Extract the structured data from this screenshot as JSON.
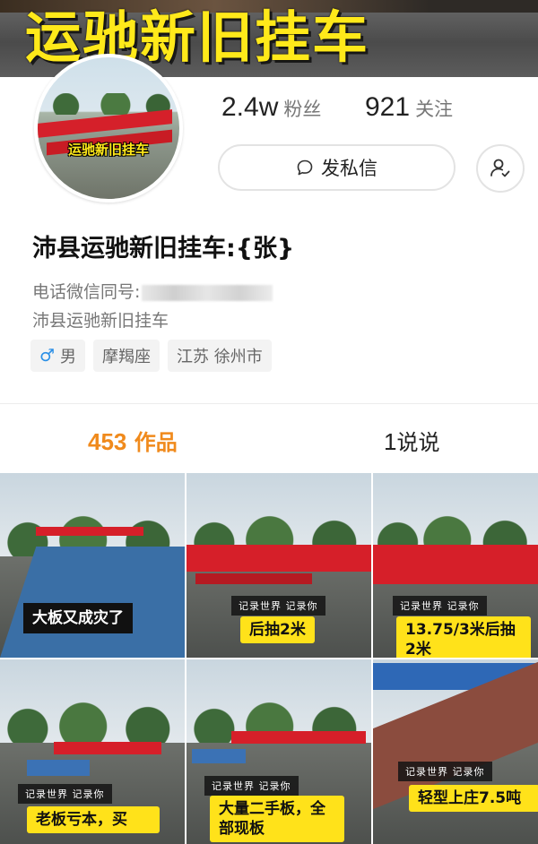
{
  "banner": {
    "title": "运驰新旧挂车"
  },
  "avatar": {
    "label": "运驰新旧挂车"
  },
  "stats": {
    "fans_count": "2.4w",
    "fans_label": "粉丝",
    "follow_count": "921",
    "follow_label": "关注"
  },
  "actions": {
    "message_label": "发私信"
  },
  "profile": {
    "name": "沛县运驰新旧挂车:{张}",
    "bio_line1": "电话微信同号:",
    "bio_line2": "沛县运驰新旧挂车",
    "tags": {
      "gender": "男",
      "zodiac": "摩羯座",
      "location": "江苏 徐州市"
    }
  },
  "tabs": {
    "works_count": "453",
    "works_label": "作品",
    "talk_count": "1",
    "talk_label": "说说"
  },
  "videos": [
    {
      "caption": "大板又成灾了"
    },
    {
      "record": "记录世界 记录你",
      "caption": "后抽2米"
    },
    {
      "record": "记录世界 记录你",
      "caption": "13.75/3米后抽2米"
    },
    {
      "record": "记录世界 记录你",
      "caption": "老板亏本，买"
    },
    {
      "record": "记录世界 记录你",
      "caption": "大量二手板，全部现板"
    },
    {
      "record": "记录世界 记录你",
      "caption": "轻型上庄7.5吨"
    }
  ],
  "colors": {
    "accent": "#f08a1c",
    "banner_text": "#ffe91a",
    "male": "#2a8fe6"
  }
}
